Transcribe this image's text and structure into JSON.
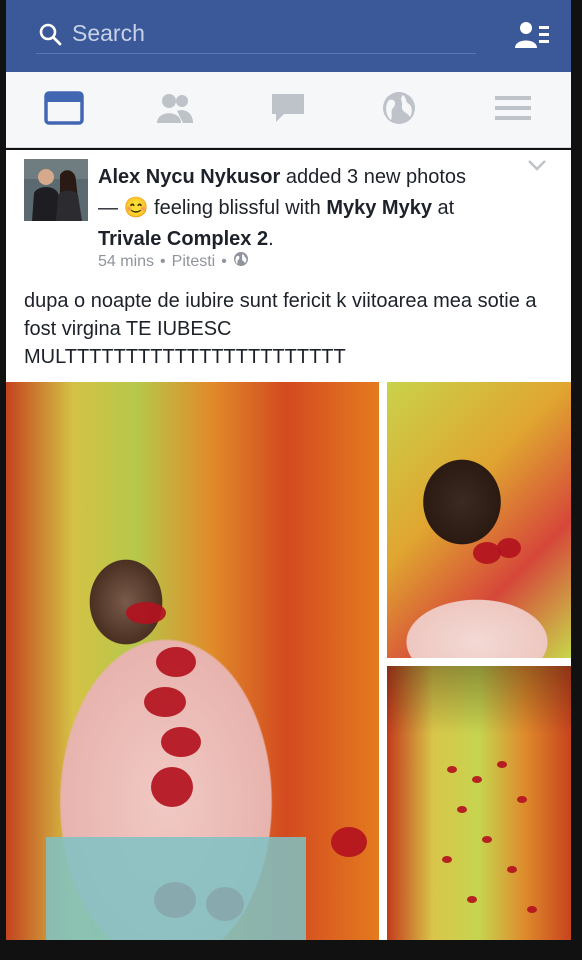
{
  "search": {
    "placeholder": "Search"
  },
  "nav": [
    {
      "name": "news-feed",
      "icon": "news-feed-icon",
      "active": true
    },
    {
      "name": "friend-requests",
      "icon": "friends-icon",
      "active": false
    },
    {
      "name": "messages",
      "icon": "chat-bubble-icon",
      "active": false
    },
    {
      "name": "notifications",
      "icon": "globe-icon",
      "active": false
    },
    {
      "name": "menu",
      "icon": "hamburger-icon",
      "active": false
    }
  ],
  "post": {
    "author": "Alex Nycu Nykusor",
    "action": "added 3 new photos",
    "dash": "—",
    "feeling_emoji": "😊",
    "feeling": "feeling blissful with",
    "tagged": "Myky Myky",
    "at_word": "at",
    "place": "Trivale Complex 2",
    "period": ".",
    "time": "54 mins",
    "location": "Pitesti",
    "body": "dupa o noapte de iubire sunt fericit k  viitoarea mea sotie a fost virgina TE IUBESC MULTTTTTTTTTTTTTTTTTTTTTTT"
  },
  "colors": {
    "brand": "#3b5998",
    "text": "#1d2129",
    "muted": "#90949c"
  }
}
